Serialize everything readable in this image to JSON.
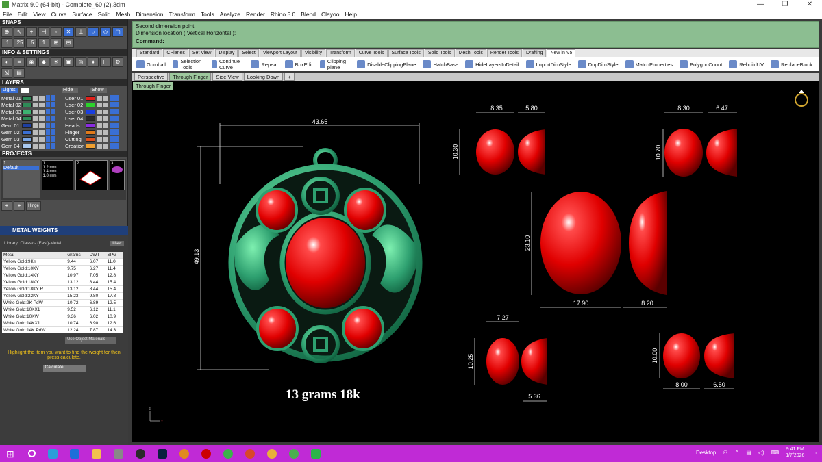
{
  "window": {
    "title": "Matrix 9.0 (64-bit) - Complete_60 (2).3dm",
    "controls": [
      "—",
      "❐",
      "✕"
    ]
  },
  "menu": [
    "File",
    "Edit",
    "View",
    "Curve",
    "Surface",
    "Solid",
    "Mesh",
    "Dimension",
    "Transform",
    "Tools",
    "Analyze",
    "Render",
    "Rhino 5.0",
    "Blend",
    "Clayoo",
    "Help"
  ],
  "panels": {
    "snaps": "SNAPS",
    "info": "INFO & SETTINGS",
    "layers": "LAYERS",
    "projects": "PROJECTS"
  },
  "layers": {
    "lights": "Lights",
    "hide_label": "Hide",
    "show_label": "Show",
    "left": [
      {
        "name": "Metal 01",
        "color": "#2e8b57"
      },
      {
        "name": "Metal 02",
        "color": "#2e8b57"
      },
      {
        "name": "Metal 03",
        "color": "#3cb371"
      },
      {
        "name": "Metal 04",
        "color": "#2e8b57"
      },
      {
        "name": "Gem 01",
        "color": "#1e3fa0"
      },
      {
        "name": "Gem 02",
        "color": "#3a6fd4"
      },
      {
        "name": "Gem 03",
        "color": "#7aa7e6"
      },
      {
        "name": "Gem 04",
        "color": "#a8c8f0"
      }
    ],
    "right": [
      {
        "name": "User 01",
        "color": "#e0201a"
      },
      {
        "name": "User 02",
        "color": "#2bd12b"
      },
      {
        "name": "User 03",
        "color": "#1a3fe0"
      },
      {
        "name": "User 04",
        "color": "#2a2a2a"
      },
      {
        "name": "Heads",
        "color": "#8a2be2"
      },
      {
        "name": "Finger",
        "color": "#e07a1a"
      },
      {
        "name": "Cutting",
        "color": "#e0501a"
      },
      {
        "name": "Creation",
        "color": "#f0a030"
      }
    ]
  },
  "projects": {
    "list": [
      "1",
      "Default"
    ],
    "thumbs": [
      "1",
      "2",
      "3"
    ],
    "thumb1_items": [
      "1.2 mm",
      "1.4 mm",
      "1.8 mm",
      "1.2 mm",
      "1.8 mm"
    ],
    "button": "Hinge"
  },
  "metal_weights": {
    "title": "METAL WEIGHTS",
    "library": "Library: Classic- (Fast)-Metal",
    "user_btn": "User",
    "columns": [
      "Metal",
      "Grams",
      "DWT",
      "SPG"
    ],
    "rows": [
      [
        "Yellow Gold:9KY",
        "9.44",
        "6.07",
        "11.0"
      ],
      [
        "Yellow Gold:10KY",
        "9.75",
        "6.27",
        "11.4"
      ],
      [
        "Yellow Gold:14KY",
        "10.97",
        "7.05",
        "12.8"
      ],
      [
        "Yellow Gold:18KY",
        "13.12",
        "8.44",
        "15.4"
      ],
      [
        "Yellow Gold:18KY R...",
        "13.12",
        "8.44",
        "15.4"
      ],
      [
        "Yellow Gold:22KY",
        "15.23",
        "9.80",
        "17.8"
      ],
      [
        "White Gold:9K PdW",
        "10.72",
        "6.89",
        "12.5"
      ],
      [
        "White Gold:10KX1",
        "9.52",
        "6.12",
        "11.1"
      ],
      [
        "White Gold:10KW",
        "9.36",
        "6.02",
        "10.9"
      ],
      [
        "White Gold:14KX1",
        "10.74",
        "6.90",
        "12.6"
      ],
      [
        "White Gold:14K PdW",
        "12.24",
        "7.87",
        "14.3"
      ]
    ],
    "use_object_materials": "Use Object Materials",
    "note": "Highlight the item you want to find the weight for then press calculate.",
    "calculate": "Calculate"
  },
  "command": {
    "line1": "Second dimension point:",
    "line2": "Dimension location ( Vertical  Horizontal ):",
    "prompt": "Command:"
  },
  "tabs": [
    "Standard",
    "CPlanes",
    "Set View",
    "Display",
    "Select",
    "Viewport Layout",
    "Visibility",
    "Transform",
    "Curve Tools",
    "Surface Tools",
    "Solid Tools",
    "Mesh Tools",
    "Render Tools",
    "Drafting",
    "New in V5"
  ],
  "active_tab": "New in V5",
  "tools": [
    "Gumball",
    "Selection Tools",
    "Continue Curve",
    "Repeat",
    "BoxEdit",
    "Clipping plane",
    "DisableClippingPlane",
    "HatchBase",
    "HideLayersInDetail",
    "ImportDimStyle",
    "DupDimStyle",
    "MatchProperties",
    "PolygonCount",
    "RebuildUV",
    "ReplaceBlock"
  ],
  "viewport_tabs": [
    "Perspective",
    "Through Finger",
    "Side View",
    "Looking Down",
    "+"
  ],
  "active_viewport": "Through Finger",
  "viewport_title": "Through Finger",
  "dimensions": {
    "pendant_width": "43.65",
    "pendant_height": "49.13",
    "g1_w": "8.35",
    "g1_d": "5.80",
    "g1_h": "10.30",
    "g2_w": "8.30",
    "g2_d": "6.47",
    "g2_h": "10.70",
    "g3_w": "17.90",
    "g3_d": "8.20",
    "g3_h": "23.10",
    "g4_w": "7.27",
    "g4_d": "5.36",
    "g4_h": "10.25",
    "g5_w": "8.00",
    "g5_d": "6.50",
    "g5_h": "10.00"
  },
  "caption": "13 grams 18k",
  "axis": {
    "z": "z",
    "x": "x"
  },
  "taskbar": {
    "desktop": "Desktop",
    "time": "9:41 PM",
    "date": "1/7/2026"
  }
}
